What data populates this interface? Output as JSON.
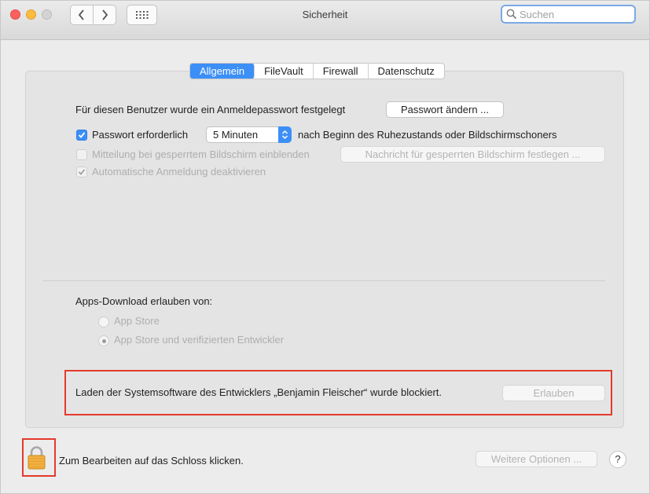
{
  "window": {
    "title": "Sicherheit"
  },
  "search": {
    "placeholder": "Suchen",
    "value": ""
  },
  "tabs": [
    "Allgemein",
    "FileVault",
    "Firewall",
    "Datenschutz"
  ],
  "general": {
    "password_set_text": "Für diesen Benutzer wurde ein Anmeldepasswort festgelegt",
    "change_password_button": "Passwort ändern ...",
    "require_password_label": "Passwort erforderlich",
    "require_password_checked": true,
    "delay_value": "5 Minuten",
    "after_sleep_text": "nach Beginn des Ruhezustands oder Bildschirmschoners",
    "show_message_label": "Mitteilung bei gesperrtem Bildschirm einblenden",
    "show_message_checked": false,
    "set_lock_message_button": "Nachricht für gesperrten Bildschirm festlegen ...",
    "disable_autologin_label": "Automatische Anmeldung deaktivieren",
    "disable_autologin_checked": true
  },
  "downloads": {
    "heading": "Apps-Download erlauben von:",
    "options": [
      "App Store",
      "App Store und verifizierten Entwickler"
    ],
    "selected": "App Store und verifizierten Entwickler"
  },
  "blocked": {
    "message": "Laden der Systemsoftware des Entwicklers „Benjamin Fleischer“ wurde blockiert.",
    "allow_button": "Erlauben"
  },
  "footer": {
    "lock_text": "Zum Bearbeiten auf das Schloss klicken.",
    "more_options_button": "Weitere Optionen ...",
    "help_label": "?"
  },
  "colors": {
    "accent": "#3b8ff7",
    "highlight": "#e43a2d"
  },
  "icons": [
    "back-icon",
    "forward-icon",
    "grid-icon",
    "search-icon",
    "checkmark-icon",
    "chevron-updown-icon",
    "lock-icon"
  ]
}
